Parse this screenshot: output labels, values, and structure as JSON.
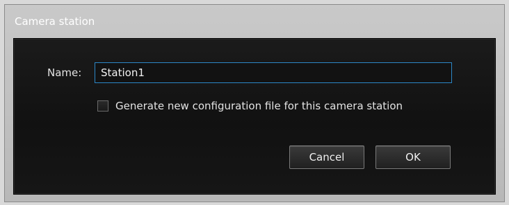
{
  "dialog": {
    "title": "Camera station",
    "name_label": "Name:",
    "name_value": "Station1",
    "checkbox": {
      "label": "Generate new configuration file for this camera station",
      "checked": false
    },
    "buttons": {
      "cancel": "Cancel",
      "ok": "OK"
    }
  },
  "colors": {
    "title_bar": "#bfbfbf",
    "client_bg": "#141414",
    "input_border_focus": "#2c88c8",
    "text": "#e3e3e3"
  }
}
